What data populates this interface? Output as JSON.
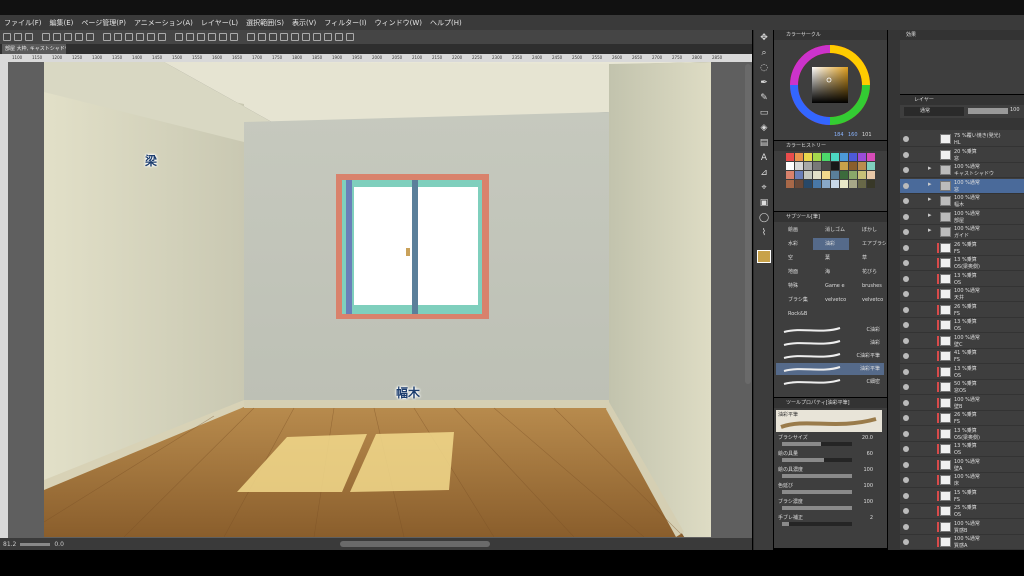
{
  "menu": [
    "ファイル(F)",
    "編集(E)",
    "ページ管理(P)",
    "アニメーション(A)",
    "レイヤー(L)",
    "選択範囲(S)",
    "表示(V)",
    "フィルター(I)",
    "ウィンドウ(W)",
    "ヘルプ(H)"
  ],
  "document_tab": "部屋 大枠, キャストシャドウ",
  "ruler_ticks": [
    "1100",
    "1150",
    "1200",
    "1250",
    "1300",
    "1350",
    "1400",
    "1450",
    "1500",
    "1550",
    "1600",
    "1650",
    "1700",
    "1750",
    "1800",
    "1850",
    "1900",
    "1950",
    "2000",
    "2050",
    "2100",
    "2150",
    "2200",
    "2250",
    "2300",
    "2350",
    "2400",
    "2450",
    "2500",
    "2550",
    "2600",
    "2650",
    "2700",
    "2750",
    "2800",
    "2850"
  ],
  "canvas_labels": {
    "beam": "梁",
    "baseboard": "幅木"
  },
  "status": {
    "zoom": "81.2",
    "angle": "0.0"
  },
  "color_panel": {
    "title": "カラーサークル",
    "h": "184",
    "s": "160",
    "v": "101",
    "main_color": "#c8a24a"
  },
  "history_title": "カラーヒストリー",
  "subtool_panel": {
    "title": "サブツール[筆]",
    "groups": [
      "絵画",
      "消しゴム",
      "ぼかし",
      "水彩",
      "油彩",
      "エアブラシ",
      "空",
      "葉",
      "草",
      "地面",
      "海",
      "花びら",
      "特殊",
      "Game e",
      "brushes",
      "ブラシ集",
      "velvetco",
      "velvetco",
      "Rock&B"
    ],
    "brushes": [
      "C油彩",
      "油彩",
      "C油彩平筆",
      "油彩平筆",
      "C細密"
    ]
  },
  "tool_property": {
    "title": "ツールプロパティ[油彩平筆]",
    "preview_label": "油彩平筆",
    "props": [
      {
        "label": "ブラシサイズ",
        "value": "20.0",
        "fill": 0.55
      },
      {
        "label": "絵の具量",
        "value": "60",
        "fill": 0.6
      },
      {
        "label": "絵の具濃度",
        "value": "100",
        "fill": 1.0
      },
      {
        "label": "色延び",
        "value": "100",
        "fill": 1.0
      },
      {
        "label": "ブラシ濃度",
        "value": "100",
        "fill": 1.0
      },
      {
        "label": "手ブレ補正",
        "value": "2",
        "fill": 0.1
      }
    ]
  },
  "effect_panel": {
    "title": "効果"
  },
  "layer_panel": {
    "tab": "レイヤー",
    "blend_mode": "通常",
    "opacity": "100",
    "layers": [
      {
        "line1": "75 %覆い焼き(発光)",
        "line2": "HL"
      },
      {
        "line1": "20 %乗算",
        "line2": "窓"
      },
      {
        "line1": "100 %通常",
        "line2": "キャストシャドウ"
      },
      {
        "line1": "100 %通常",
        "line2": "窓"
      },
      {
        "line1": "100 %通常",
        "line2": "幅木"
      },
      {
        "line1": "100 %通常",
        "line2": "部屋"
      },
      {
        "line1": "100 %通常",
        "line2": "ガイド"
      },
      {
        "line1": "26 %乗算",
        "line2": "FS"
      },
      {
        "line1": "13 %乗算",
        "line2": "OS(梁奥側)"
      },
      {
        "line1": "13 %乗算",
        "line2": "OS"
      },
      {
        "line1": "100 %通常",
        "line2": "天井"
      },
      {
        "line1": "26 %乗算",
        "line2": "FS"
      },
      {
        "line1": "13 %乗算",
        "line2": "OS"
      },
      {
        "line1": "100 %通常",
        "line2": "壁C"
      },
      {
        "line1": "41 %乗算",
        "line2": "FS"
      },
      {
        "line1": "13 %乗算",
        "line2": "OS"
      },
      {
        "line1": "50 %乗算",
        "line2": "窓OS"
      },
      {
        "line1": "100 %通常",
        "line2": "壁B"
      },
      {
        "line1": "26 %乗算",
        "line2": "FS"
      },
      {
        "line1": "13 %乗算",
        "line2": "OS(梁奥側)"
      },
      {
        "line1": "13 %乗算",
        "line2": "OS"
      },
      {
        "line1": "100 %通常",
        "line2": "壁A"
      },
      {
        "line1": "100 %通常",
        "line2": "床"
      },
      {
        "line1": "15 %乗算",
        "line2": "FS"
      },
      {
        "line1": "25 %乗算",
        "line2": "OS"
      },
      {
        "line1": "100 %通常",
        "line2": "質感B"
      },
      {
        "line1": "100 %通常",
        "line2": "質感A"
      }
    ]
  }
}
